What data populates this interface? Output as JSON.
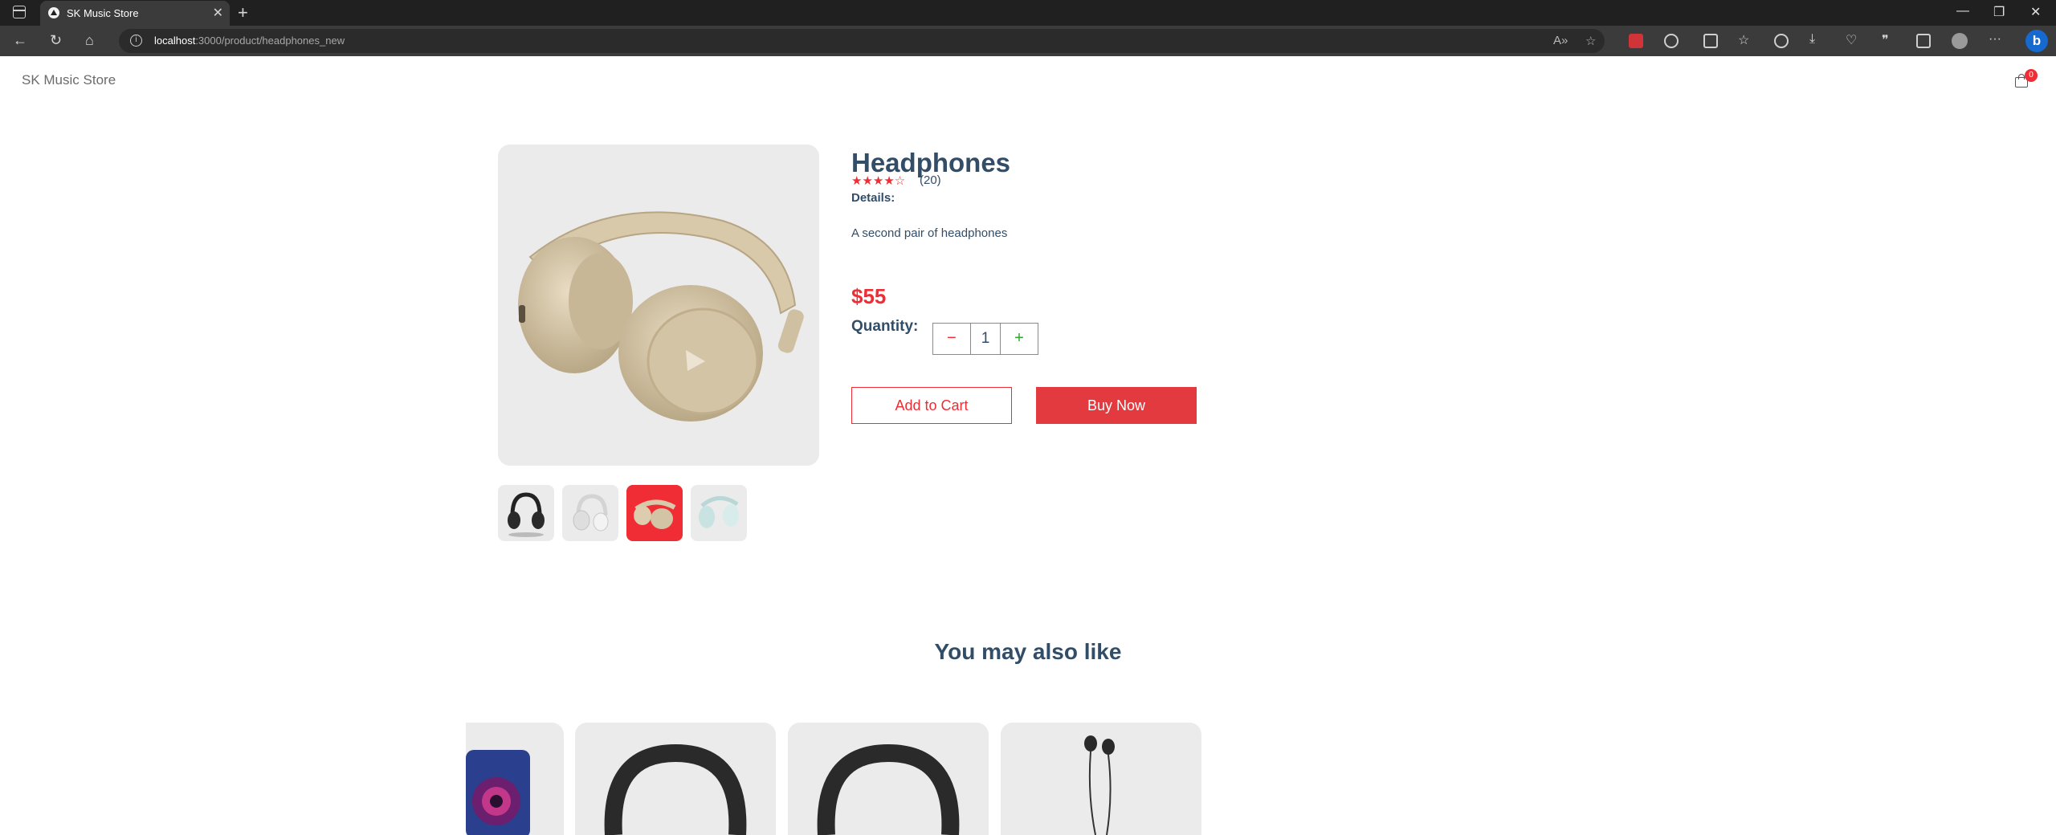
{
  "browser": {
    "tab_title": "SK Music Store",
    "url_host": "localhost",
    "url_path": ":3000/product/headphones_new",
    "extension_badge_count": ""
  },
  "header": {
    "brand": "SK Music Store",
    "cart_count": "0"
  },
  "product": {
    "name": "Headphones",
    "stars": "★★★★☆",
    "rating": 4,
    "reviews": "(20)",
    "details_heading": "Details:",
    "details": "A second pair of headphones",
    "price": "$55",
    "quantity_label": "Quantity:",
    "quantity": "1",
    "minus": "−",
    "plus": "+",
    "add_to_cart": "Add to Cart",
    "buy_now": "Buy Now",
    "thumbnails": [
      {
        "name": "black headphones",
        "selected": false
      },
      {
        "name": "white headphones",
        "selected": false
      },
      {
        "name": "beige headphones",
        "selected": true
      },
      {
        "name": "mint headphones",
        "selected": false
      }
    ]
  },
  "recommendations": {
    "heading": "You may also like",
    "items": [
      "speaker",
      "headphones",
      "headphones",
      "earphones"
    ]
  },
  "colors": {
    "accent": "#f02d34",
    "text": "#324d67",
    "plus": "#31a831",
    "image_bg": "#ebebeb"
  }
}
